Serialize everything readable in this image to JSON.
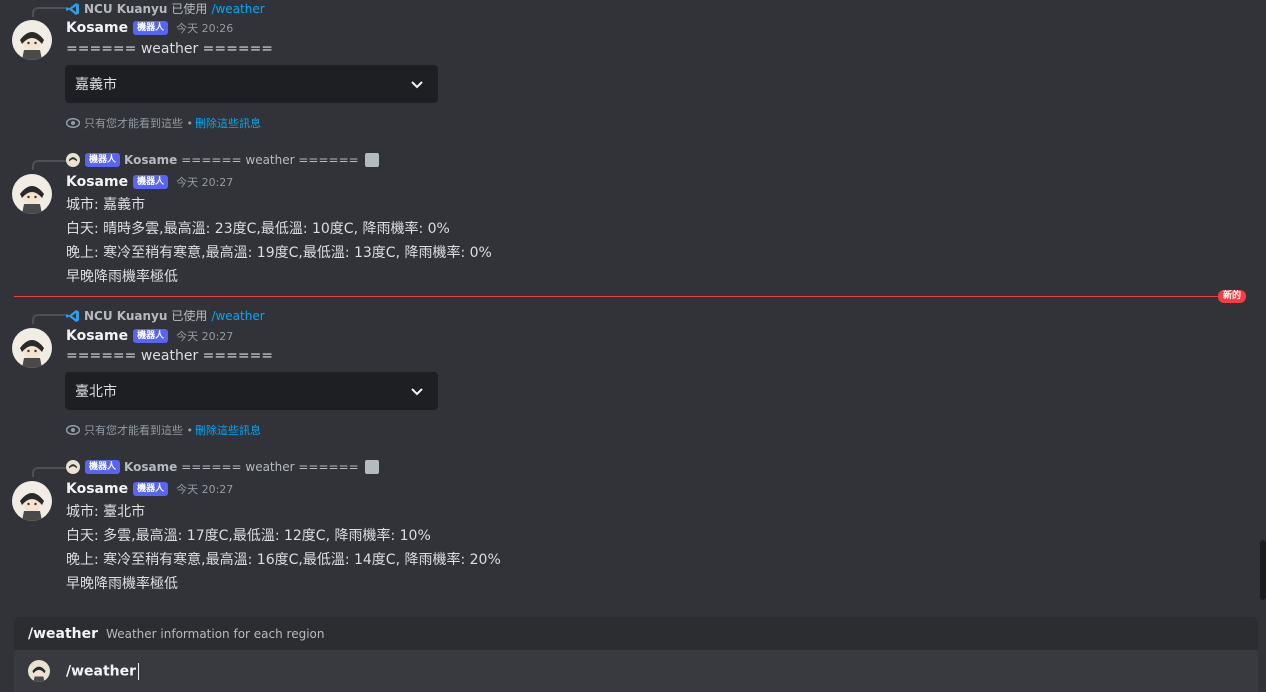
{
  "messages": [
    {
      "reply": {
        "author": "NCU Kuanyu",
        "used": "已使用",
        "command": "/weather"
      },
      "username": "Kosame",
      "bot_tag": "機器人",
      "time": "今天 20:26",
      "lines": [
        "====== weather ======"
      ],
      "select_value": "嘉義市",
      "ephemeral_note": "只有您才能看到這些 •",
      "dismiss_label": "刪除這些訊息"
    },
    {
      "reply": {
        "bot_tag": "機器人",
        "author": "Kosame",
        "text": "====== weather ======"
      },
      "username": "Kosame",
      "bot_tag": "機器人",
      "time": "今天 20:27",
      "lines": [
        "城市: 嘉義市",
        "白天: 晴時多雲,最高溫: 23度C,最低溫: 10度C, 降雨機率: 0%",
        "晚上: 寒冷至稍有寒意,最高溫: 19度C,最低溫: 13度C, 降雨機率: 0%",
        "早晚降雨機率極低"
      ]
    },
    {
      "reply": {
        "author": "NCU Kuanyu",
        "used": "已使用",
        "command": "/weather"
      },
      "username": "Kosame",
      "bot_tag": "機器人",
      "time": "今天 20:27",
      "lines": [
        "====== weather ======"
      ],
      "select_value": "臺北市",
      "ephemeral_note": "只有您才能看到這些 •",
      "dismiss_label": "刪除這些訊息"
    },
    {
      "reply": {
        "bot_tag": "機器人",
        "author": "Kosame",
        "text": "====== weather ======"
      },
      "username": "Kosame",
      "bot_tag": "機器人",
      "time": "今天 20:27",
      "lines": [
        "城市: 臺北市",
        "白天: 多雲,最高溫: 17度C,最低溫: 12度C, 降雨機率: 10%",
        "晚上: 寒冷至稍有寒意,最高溫: 16度C,最低溫: 14度C, 降雨機率: 20%",
        "早晚降雨機率極低"
      ]
    }
  ],
  "new_divider_label": "新的",
  "command_popup": {
    "name": "/weather",
    "description": "Weather information for each region"
  },
  "input": {
    "value": "/weather"
  },
  "colors": {
    "accent": "#5865f2",
    "link": "#00a8fc",
    "new_divider": "#f23f43",
    "background": "#313338"
  }
}
